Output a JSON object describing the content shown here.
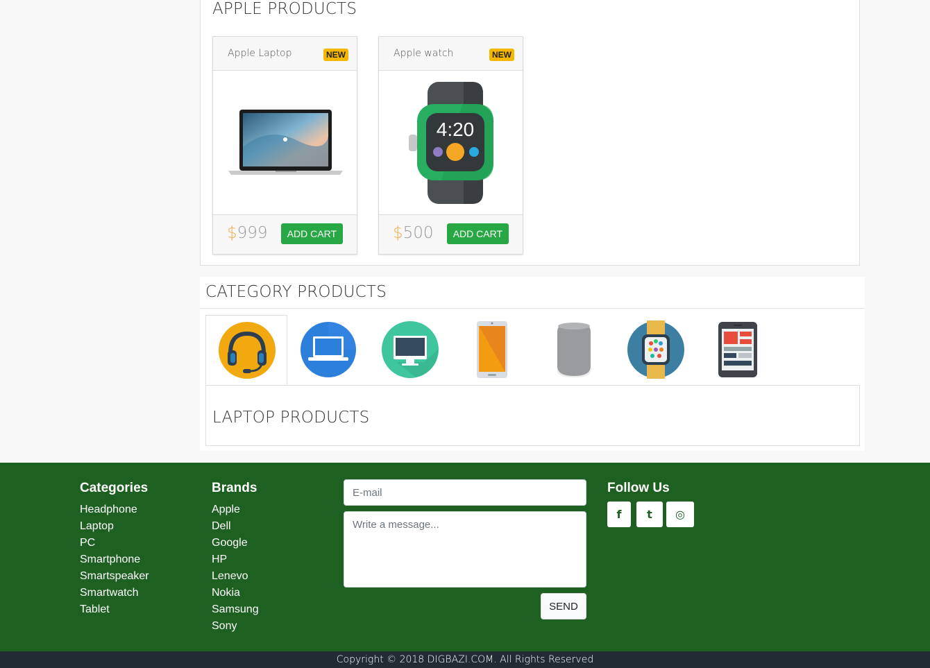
{
  "apple_section": {
    "title": "APPLE PRODUCTS",
    "products": [
      {
        "name": "Apple Laptop",
        "badge": "NEW",
        "currency": "$",
        "price": "999",
        "button": "ADD CART"
      },
      {
        "name": "Apple watch",
        "badge": "NEW",
        "currency": "$",
        "price": "500",
        "button": "ADD CART",
        "watch_time": "4:20"
      }
    ]
  },
  "category_section": {
    "title": "CATEGORY PRODUCTS",
    "tabs": [
      {
        "icon": "headphone-icon",
        "active": true
      },
      {
        "icon": "laptop-icon",
        "active": false
      },
      {
        "icon": "pc-monitor-icon",
        "active": false
      },
      {
        "icon": "smartphone-icon",
        "active": false
      },
      {
        "icon": "smartspeaker-icon",
        "active": false
      },
      {
        "icon": "smartwatch-icon",
        "active": false
      },
      {
        "icon": "tablet-icon",
        "active": false
      }
    ],
    "active_title": "LAPTOP PRODUCTS"
  },
  "footer": {
    "categories_title": "Categories",
    "categories": [
      "Headphone",
      "Laptop",
      "PC",
      "Smartphone",
      "Smartspeaker",
      "Smartwatch",
      "Tablet"
    ],
    "brands_title": "Brands",
    "brands": [
      "Apple",
      "Dell",
      "Google",
      "HP",
      "Lenevo",
      "Nokia",
      "Samsung",
      "Sony"
    ],
    "email_placeholder": "E-mail",
    "message_placeholder": "Write a message...",
    "send_label": "SEND",
    "follow_title": "Follow Us",
    "social": [
      {
        "icon": "facebook-icon",
        "glyph": "f"
      },
      {
        "icon": "twitter-icon",
        "glyph": "t"
      },
      {
        "icon": "instagram-icon",
        "glyph": "◎"
      }
    ],
    "copyright": "Copyright © 2018 DIGBAZI.COM. All Rights Reserved"
  },
  "colors": {
    "footer_bg": "#1d6021",
    "add_cart": "#28a745",
    "badge": "#f5b700",
    "price_currency": "#f0ad4e",
    "copyright_bg": "#222a33"
  }
}
